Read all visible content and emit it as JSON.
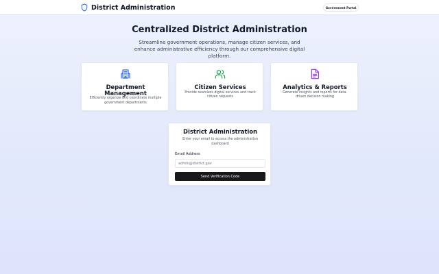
{
  "header": {
    "title": "District Administration",
    "badge": "Government Portal",
    "shield_icon": "shield-icon",
    "accent_color": "#2563eb"
  },
  "hero": {
    "title": "Centralized District Administration",
    "subtitle": "Streamline government operations, manage citizen services, and enhance administrative efficiency through our comprehensive digital platform."
  },
  "features": [
    {
      "icon": "building-icon",
      "icon_color": "#2563eb",
      "title": "Department Management",
      "description": "Efficiently organize and coordinate multiple government departments"
    },
    {
      "icon": "users-icon",
      "icon_color": "#16a34a",
      "title": "Citizen Services",
      "description": "Provide seamless digital services and track citizen requests"
    },
    {
      "icon": "document-icon",
      "icon_color": "#9333ea",
      "title": "Analytics & Reports",
      "description": "Generate insights and reports for data-driven decision making"
    }
  ],
  "login": {
    "title": "District Administration",
    "subtitle": "Enter your email to access the administration dashboard",
    "email_label": "Email Address",
    "email_value": "",
    "email_placeholder": "admin@district.gov",
    "submit_label": "Send Verification Code",
    "button_color": "#18181b"
  }
}
